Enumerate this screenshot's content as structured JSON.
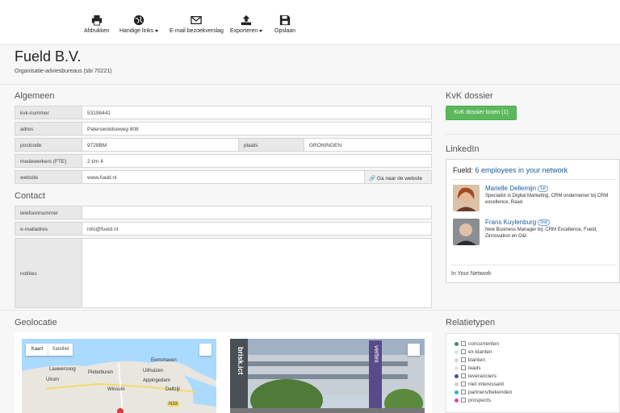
{
  "toolbar": {
    "print": "Afdrukken",
    "links": "Handige links",
    "email": "E-mail bezoekverslag",
    "export": "Exporteren",
    "save": "Opslaan"
  },
  "company": {
    "name": "Fueld B.V.",
    "subtitle": "Organisatie-adviesbureaus (sbi 70221)"
  },
  "sections": {
    "general": "Algemeen",
    "contact": "Contact",
    "geo": "Geolocatie",
    "kvk": "KvK dossier",
    "linkedin": "LinkedIn",
    "relations": "Relatietypen"
  },
  "general": {
    "kvk_label": "kvk-nummer",
    "kvk_value": "53198441",
    "address_label": "adres",
    "address_value": "Paterswoldseweg 808",
    "postcode_label": "postcode",
    "postcode_value": "9728BM",
    "city_label": "plaats",
    "city_value": "GRONINGEN",
    "employees_label": "medewerkers (FTE)",
    "employees_value": "2 t/m 4",
    "website_label": "website",
    "website_value": "www.fueld.nl",
    "website_button": "Ga naar de website"
  },
  "contact": {
    "phone_label": "telefoonnummer",
    "phone_value": "",
    "email_label": "e-mailadres",
    "email_value": "info@fueld.nl",
    "notes_label": "notities"
  },
  "kvk": {
    "button": "KvK dossier tonen (1)"
  },
  "linkedin": {
    "title_prefix": "Fueld:",
    "title_link": "6 employees in your network",
    "people": [
      {
        "name": "Marielle Dellemijn",
        "degree": "1st",
        "desc": "Specialist in Digital Marketing, CRM ondernemer bij CRM excellence, Raad"
      },
      {
        "name": "Frans Kuylenburg",
        "degree": "2nd",
        "desc": "New Business Manager bij: CRM Excellence, Fueld, Zinnovation en O&I"
      }
    ],
    "footer": "In Your Network"
  },
  "relations": [
    {
      "label": "concurrenten",
      "color": "#3a8a7a"
    },
    {
      "label": "ex klanten",
      "color": "#c9ecd9"
    },
    {
      "label": "klanten",
      "color": "#d6d6d6"
    },
    {
      "label": "leads",
      "color": "#f2dce7"
    },
    {
      "label": "leveranciers",
      "color": "#4a4aa6"
    },
    {
      "label": "niet interessant",
      "color": "#d0d0d0"
    },
    {
      "label": "partners/bekenden",
      "color": "#28b4d8"
    },
    {
      "label": "prospects",
      "color": "#d64da6"
    }
  ],
  "map": {
    "tab_map": "Kaart",
    "tab_sat": "Satelliet",
    "towns": [
      "Eemshaven",
      "Lauwersoog",
      "Pieterburen",
      "Uithuizen",
      "Ulrum",
      "Winsum",
      "Appingedam",
      "Delfzijl"
    ],
    "road": "N33"
  },
  "streetview": {
    "sign1": "brisk.ict",
    "sign2": "vertex"
  },
  "colors": {
    "accent_blue": "#1c5a9c",
    "kvk_green": "#5cb85c"
  }
}
